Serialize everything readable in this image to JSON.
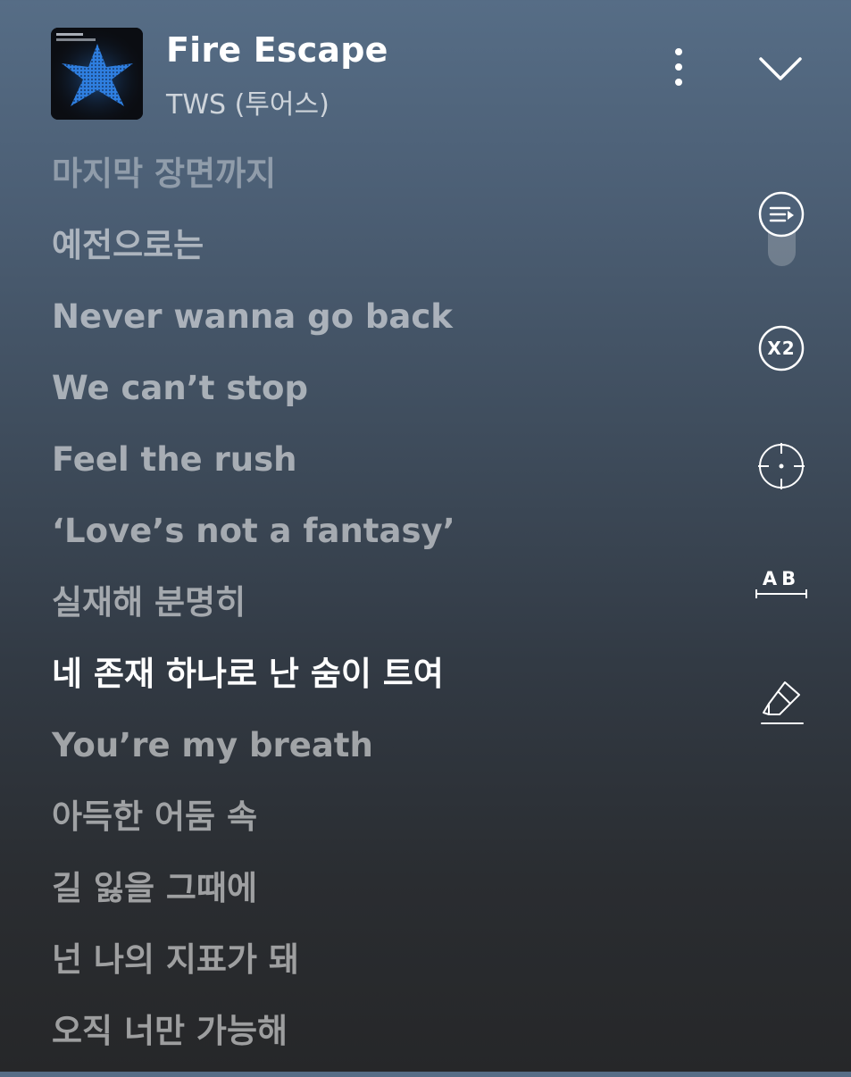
{
  "track": {
    "title": "Fire Escape",
    "artist": "TWS (투어스)"
  },
  "header": {
    "more_icon": "more-vertical-icon",
    "collapse_icon": "chevron-down-icon"
  },
  "lyrics": [
    "마지막 장면까지",
    "예전으로는",
    "Never wanna go back",
    "We can’t stop",
    "Feel the rush",
    "‘Love’s not a fantasy’",
    "실재해 분명히",
    "네 존재 하나로 난 숨이 트여",
    "You’re my breath",
    "아득한 어둠 속",
    "길 잃을 그때에",
    "넌 나의 지표가 돼",
    "오직 너만 가능해"
  ],
  "active_line_index": 7,
  "controls": {
    "autoscroll_icon": "autoscroll-icon",
    "autoscroll_on": true,
    "text_size_label": "X2",
    "focus_icon": "crosshair-icon",
    "ab_label": "AB",
    "highlight_icon": "highlighter-icon"
  },
  "colors": {
    "background_top": "#566d86",
    "background_bottom": "#262729",
    "active_lyric": "#ffffff",
    "accent_star": "#2f7fe0"
  }
}
